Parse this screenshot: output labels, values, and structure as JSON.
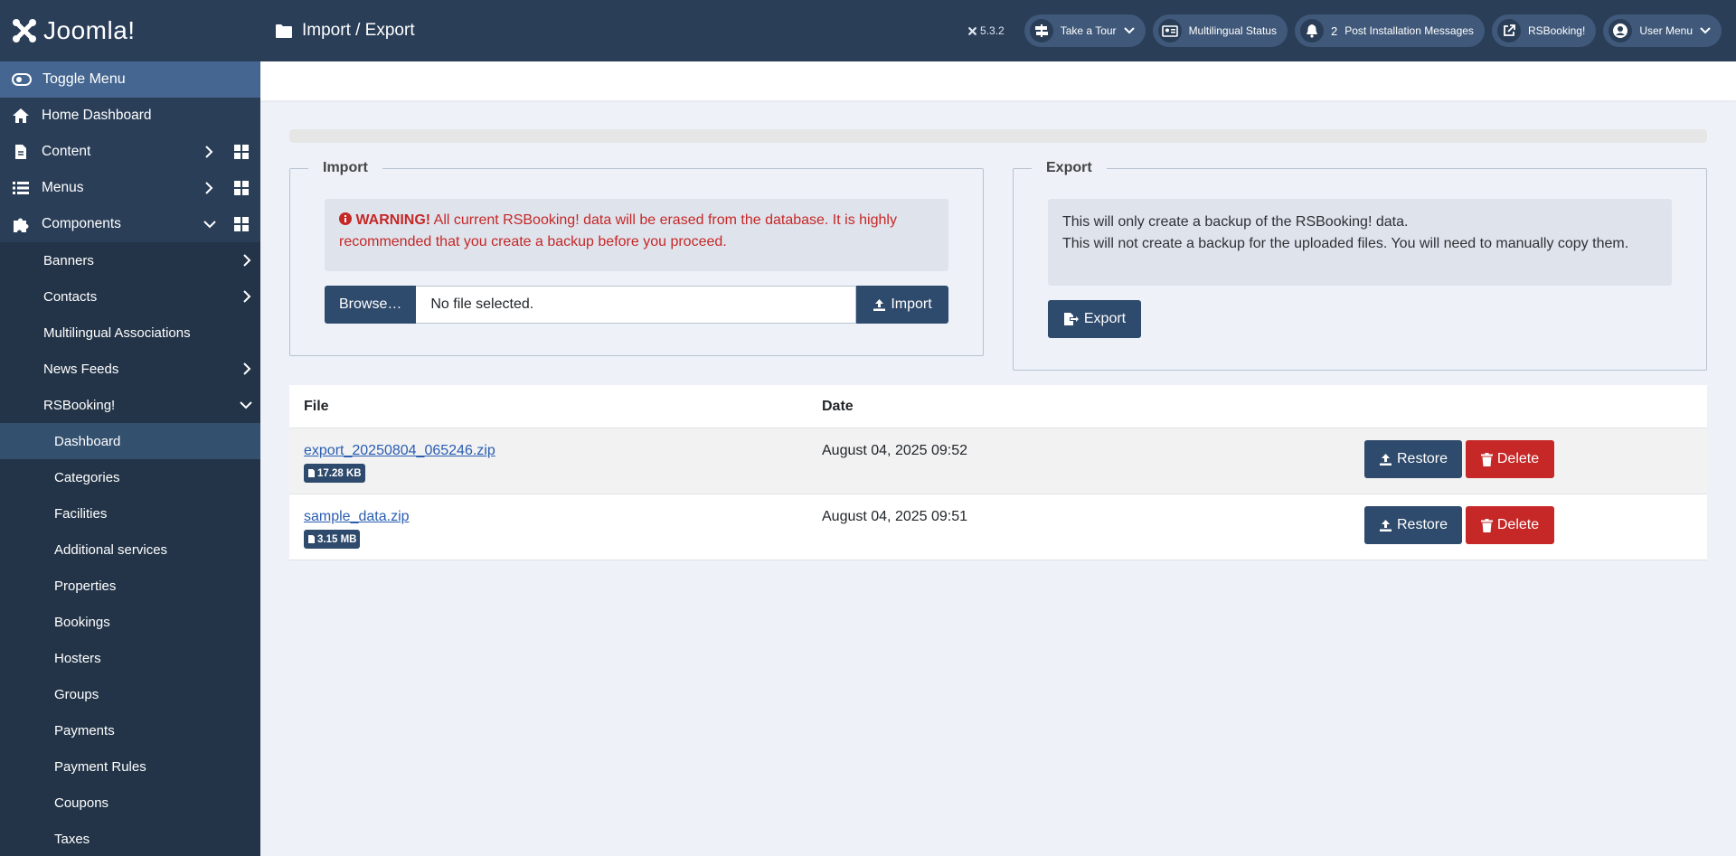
{
  "brand": {
    "name": "Joomla!"
  },
  "sidebar": {
    "toggle_label": "Toggle Menu",
    "items": [
      {
        "label": "Home Dashboard"
      },
      {
        "label": "Content"
      },
      {
        "label": "Menus"
      },
      {
        "label": "Components"
      }
    ],
    "components": [
      {
        "label": "Banners"
      },
      {
        "label": "Contacts"
      },
      {
        "label": "Multilingual Associations"
      },
      {
        "label": "News Feeds"
      },
      {
        "label": "RSBooking!"
      }
    ],
    "rsbooking": [
      {
        "label": "Dashboard"
      },
      {
        "label": "Categories"
      },
      {
        "label": "Facilities"
      },
      {
        "label": "Additional services"
      },
      {
        "label": "Properties"
      },
      {
        "label": "Bookings"
      },
      {
        "label": "Hosters"
      },
      {
        "label": "Groups"
      },
      {
        "label": "Payments"
      },
      {
        "label": "Payment Rules"
      },
      {
        "label": "Coupons"
      },
      {
        "label": "Taxes"
      }
    ]
  },
  "header": {
    "title": "Import / Export",
    "version": "5.3.2",
    "take_tour": "Take a Tour",
    "multilingual": "Multilingual Status",
    "post_install_count": "2",
    "post_install": "Post Installation Messages",
    "rsbooking": "RSBooking!",
    "user_menu": "User Menu"
  },
  "import": {
    "legend": "Import",
    "warning_title": "WARNING!",
    "warning_text": "All current RSBooking! data will be erased from the database. It is highly recommended that you create a backup before you proceed.",
    "browse_label": "Browse…",
    "file_value": "No file selected.",
    "import_label": "Import"
  },
  "export": {
    "legend": "Export",
    "line1": "This will only create a backup of the RSBooking! data.",
    "line2": "This will not create a backup for the uploaded files. You will need to manually copy them.",
    "export_label": "Export"
  },
  "table": {
    "headers": {
      "file": "File",
      "date": "Date"
    },
    "rows": [
      {
        "file": "export_20250804_065246.zip",
        "size": "17.28 KB",
        "date": "August 04, 2025 09:52"
      },
      {
        "file": "sample_data.zip",
        "size": "3.15 MB",
        "date": "August 04, 2025 09:51"
      }
    ],
    "restore_label": "Restore",
    "delete_label": "Delete"
  },
  "colors": {
    "sidebar_bg": "#2a3e58",
    "primary": "#2e4a6c",
    "danger": "#c52827",
    "page_bg": "#eef2f8"
  },
  "icons": [
    "joomla-logo-icon",
    "toggle-icon",
    "home-icon",
    "file-icon",
    "list-icon",
    "puzzle-icon",
    "grid-icon",
    "chevron-right-icon",
    "chevron-down-icon",
    "folder-icon",
    "joomla-small-icon",
    "signpost-icon",
    "id-card-icon",
    "bell-icon",
    "external-link-icon",
    "user-circle-icon",
    "info-icon",
    "upload-icon",
    "export-icon",
    "trash-icon"
  ]
}
